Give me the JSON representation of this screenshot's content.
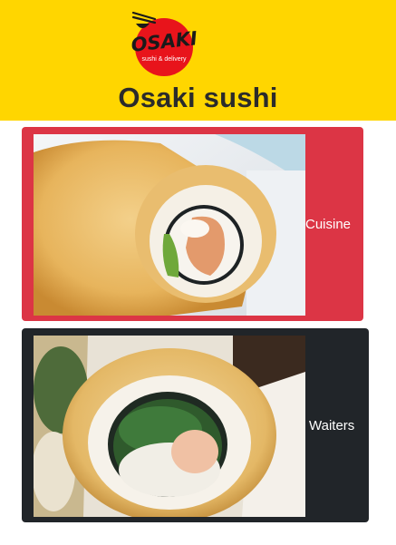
{
  "header": {
    "logo": {
      "brand": "OSAKI",
      "tagline": "sushi & delivery",
      "colors": {
        "circle": "#e8141b",
        "text": "#1a1a1a",
        "tagline": "#ffffff"
      }
    },
    "title": "Osaki sushi",
    "background": "#ffd600"
  },
  "cards": [
    {
      "label": "Cuisine",
      "background": "#dc3545",
      "image": "fried-sushi-roll-salmon-avocado-photo"
    },
    {
      "label": "Waiters",
      "background": "#212529",
      "image": "fried-sushi-roll-shrimp-cucumber-photo"
    }
  ]
}
